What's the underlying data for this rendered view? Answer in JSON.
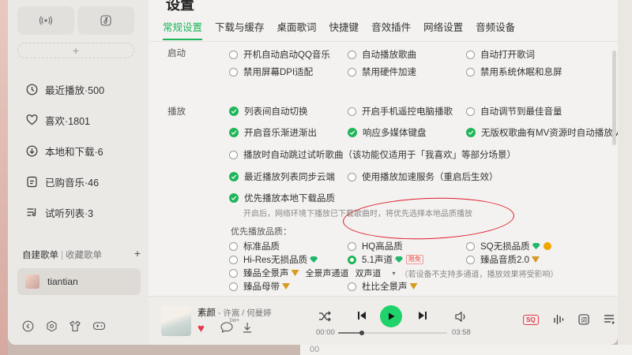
{
  "settings": {
    "title": "设置",
    "tabs": [
      "常规设置",
      "下载与缓存",
      "桌面歌词",
      "快捷键",
      "音效插件",
      "网络设置",
      "音频设备"
    ],
    "startup": {
      "label": "启动",
      "row0": [
        "开机自动启动QQ音乐",
        "自动播放歌曲",
        "自动打开歌词"
      ],
      "row1": [
        "禁用屏幕DPI适配",
        "禁用硬件加速",
        "禁用系统休眠和息屏"
      ]
    },
    "play": {
      "label": "播放",
      "r1": [
        "列表间自动切换",
        "开启手机遥控电脑播歌",
        "自动调节到最佳音量"
      ],
      "r2": [
        "开启音乐渐进渐出",
        "响应多媒体键盘",
        "无版权歌曲有MV资源时自动播放MV"
      ],
      "r3": "播放时自动跳过试听歌曲（该功能仅适用于「我喜欢」等部分场景）",
      "r4": [
        "最近播放列表同步云端",
        "使用播放加速服务（重启后生效）"
      ],
      "r5": "优先播放本地下载品质",
      "r5_hint": "开启后，网络环境下播放已下载歌曲时，将优先选择本地品质播放"
    },
    "quality": {
      "label": "优先播放品质：",
      "row1": [
        "标准品质",
        "HQ高品质",
        "SQ无损品质"
      ],
      "row2": [
        "Hi-Res无损品质",
        "5.1声道",
        "臻品音质2.0"
      ],
      "row2_tag": "限免",
      "row3_label": "臻品全景声",
      "row3_select_label": "全景声通道",
      "row3_select_value": "双声道",
      "row3_hint": "（若设备不支持多通道，播放效果将受影响）",
      "row4": [
        "臻品母带",
        "杜比全景声"
      ]
    }
  },
  "sidebar": {
    "tiles": [
      "radio-icon",
      "music-note-icon"
    ],
    "add_label": "+",
    "nav": [
      "最近播放·500",
      "喜欢·1801",
      "本地和下载·6",
      "已购音乐·46",
      "试听列表·3"
    ],
    "playlist_tabs": [
      "自建歌单",
      "收藏歌单"
    ],
    "playlist_add": "+",
    "playlists": [
      "tiantian"
    ]
  },
  "player": {
    "song": "素颜",
    "artists": " - 许嵩 / 何曼婷",
    "current_time": "00:00",
    "total_time": "03:58",
    "progress": 0.22,
    "like_icon": "♥",
    "quality_badge": "SQ",
    "comment_count": "1w+"
  },
  "colors": {
    "accent": "#1fb55a",
    "annotation": "#e0192a",
    "like": "#e8394a"
  },
  "desktop": {
    "bottom_text": "00"
  }
}
